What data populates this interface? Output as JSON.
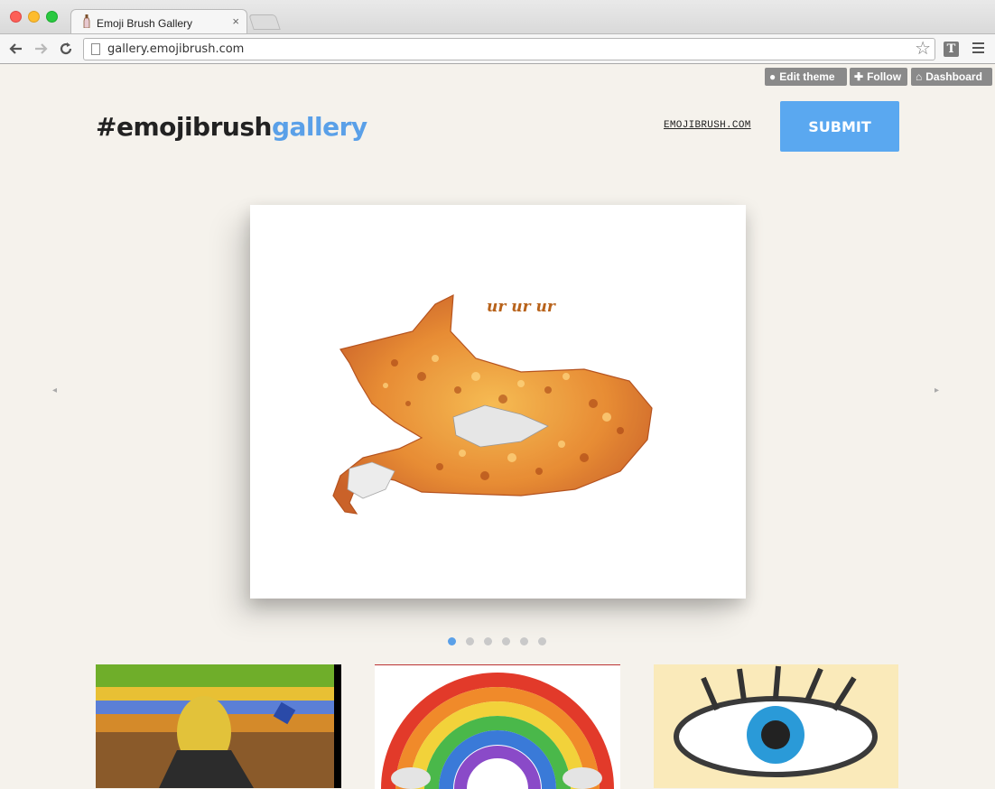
{
  "browser": {
    "tab_title": "Emoji Brush Gallery",
    "tab_close": "×",
    "url": "gallery.emojibrush.com",
    "extension_label": "T"
  },
  "controls": {
    "edit_theme": "Edit theme",
    "follow": "Follow",
    "dashboard": "Dashboard"
  },
  "site": {
    "logo_main": "#emojibrush",
    "logo_accent": "gallery",
    "link": "EMOJIBRUSH.COM",
    "submit": "SUBMIT"
  },
  "slideshow": {
    "caption": "ur ur ur",
    "prev": "◂",
    "next": "▸",
    "dot_count": 6,
    "active_dot": 0
  },
  "colors": {
    "accent": "#5aa0e8",
    "page_bg": "#f5f2ec",
    "control_bg": "#8a8a8a"
  }
}
